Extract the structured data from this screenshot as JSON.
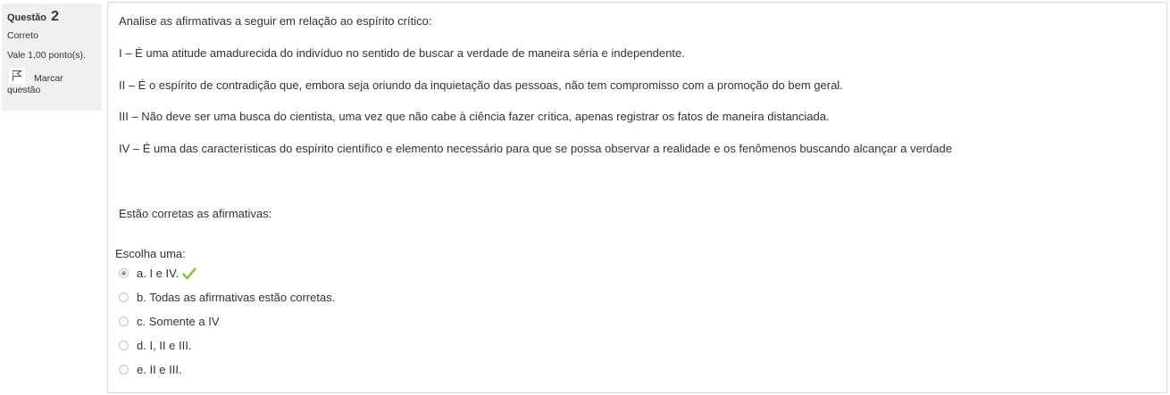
{
  "info": {
    "question_label": "Questão",
    "question_number": "2",
    "state": "Correto",
    "grade": "Vale 1,00 ponto(s).",
    "flag_label_line1": "Marcar",
    "flag_label_line2": "questão"
  },
  "question": {
    "intro": "Analise as afirmativas a seguir em relação ao espírito crítico:",
    "statements": [
      "I – É uma atitude amadurecida do indivíduo no sentido de buscar a verdade de maneira séria e independente.",
      "II – É o espírito de contradição que, embora seja oriundo da inquietação das pessoas, não tem compromisso com a promoção do bem geral.",
      "III – Não deve ser uma busca do cientista, uma vez que não cabe à ciência fazer crítica, apenas registrar os fatos de maneira distanciada.",
      "IV – É uma das características do espírito científico e elemento necessário para que se possa observar a realidade e os fenômenos buscando alcançar a verdade"
    ],
    "ask": "Estão corretas as afirmativas:",
    "prompt": "Escolha uma:",
    "options": [
      {
        "label": "a. I e IV.",
        "selected": true,
        "correct": true
      },
      {
        "label": "b. Todas as afirmativas estão corretas.",
        "selected": false
      },
      {
        "label": "c. Somente a IV",
        "selected": false
      },
      {
        "label": "d. I, II e III.",
        "selected": false
      },
      {
        "label": "e. II e III.",
        "selected": false
      }
    ],
    "icons": {
      "correct": "check-icon",
      "flag": "flag-icon"
    },
    "colors": {
      "correct": "#8bc34a",
      "info_bg": "#f0f0f0"
    }
  }
}
